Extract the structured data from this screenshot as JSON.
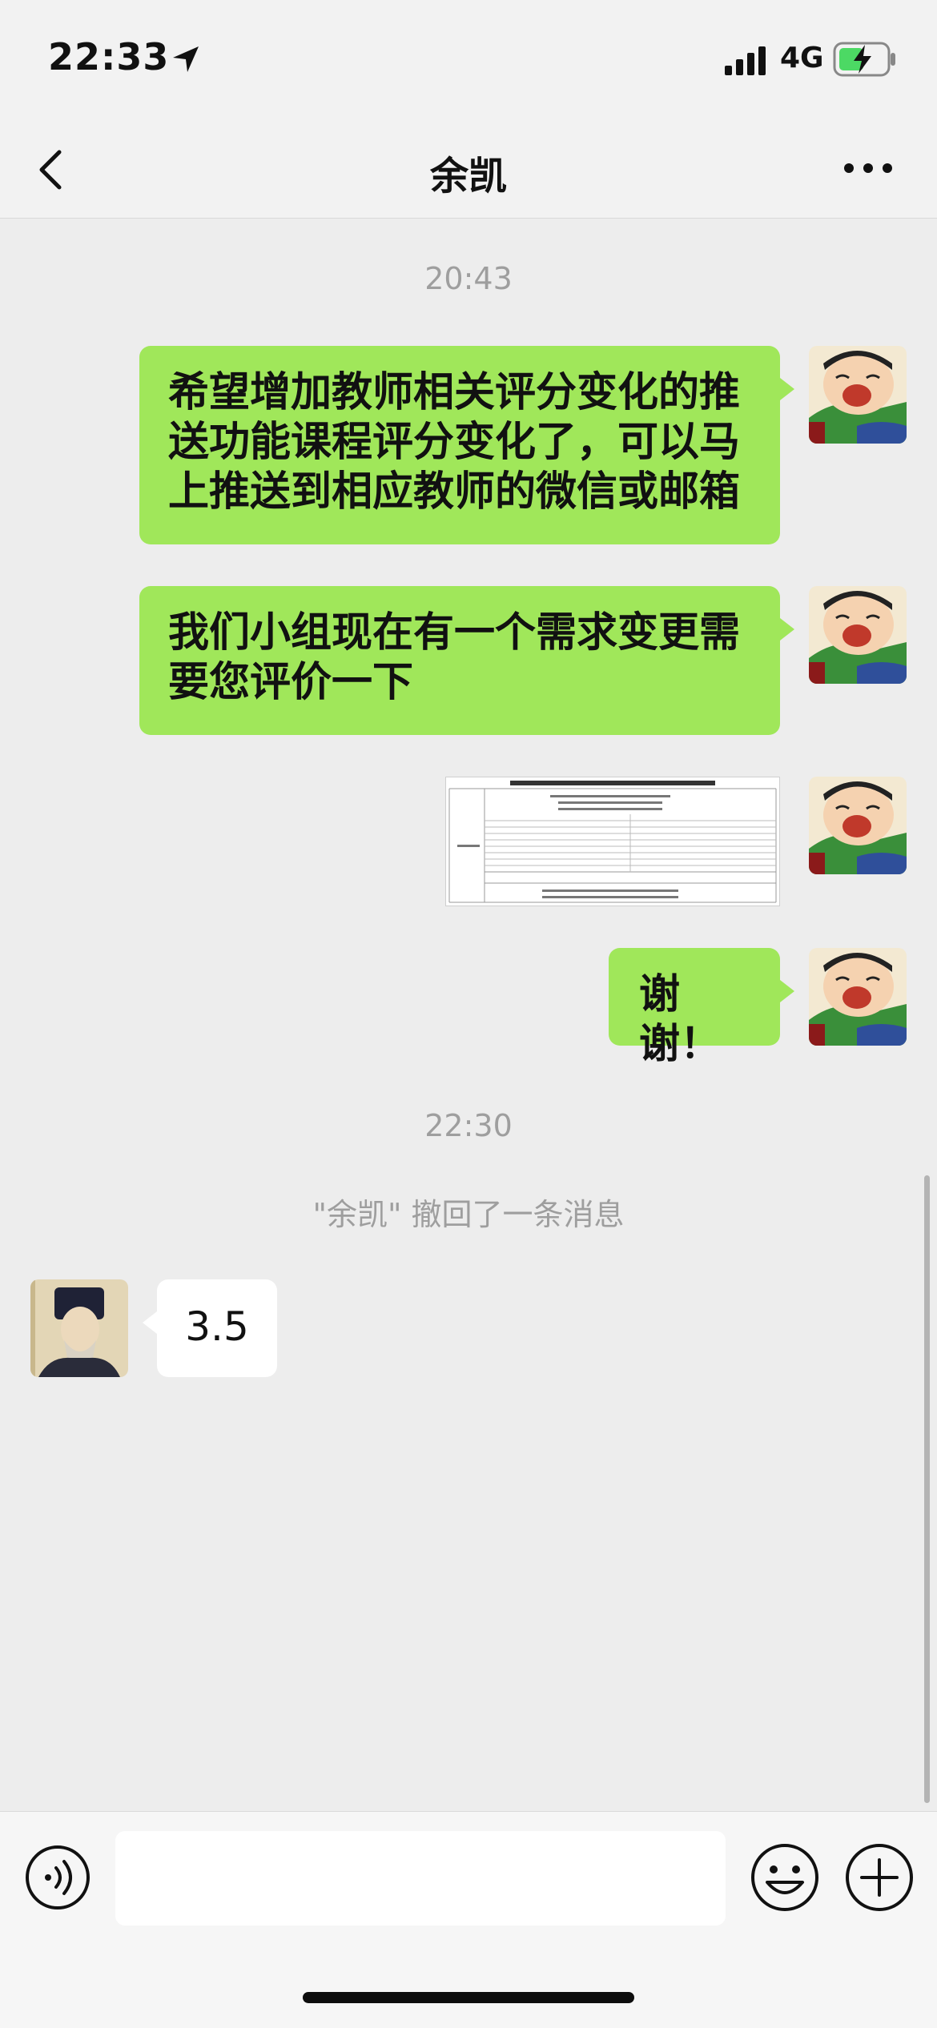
{
  "status_bar": {
    "time": "22:33",
    "network": "4G",
    "battery_charging": true
  },
  "header": {
    "title": "余凯"
  },
  "messages": [
    {
      "type": "timestamp",
      "text": "20:43"
    },
    {
      "type": "text",
      "from": "me",
      "text_lines": [
        "希望增加教师相关评分变化的推",
        "送功能课程评分变化了，可以马",
        "上推送到相应教师的微信或邮箱"
      ]
    },
    {
      "type": "text",
      "from": "me",
      "text_lines": [
        "我们小组现在有一个需求变更需",
        "要您评价一下"
      ]
    },
    {
      "type": "image",
      "from": "me",
      "description_icon": "document-table-icon"
    },
    {
      "type": "text",
      "from": "me",
      "text": "谢谢！"
    },
    {
      "type": "timestamp",
      "text": "22:30"
    },
    {
      "type": "notice",
      "text": "\"余凯\" 撤回了一条消息"
    },
    {
      "type": "text",
      "from": "other",
      "text": "3.5"
    }
  ],
  "input_bar": {
    "placeholder": ""
  },
  "colors": {
    "bubble_out": "#a0e75a",
    "bubble_in": "#ffffff",
    "background": "#ededed",
    "timestamp": "#9e9e9e"
  }
}
